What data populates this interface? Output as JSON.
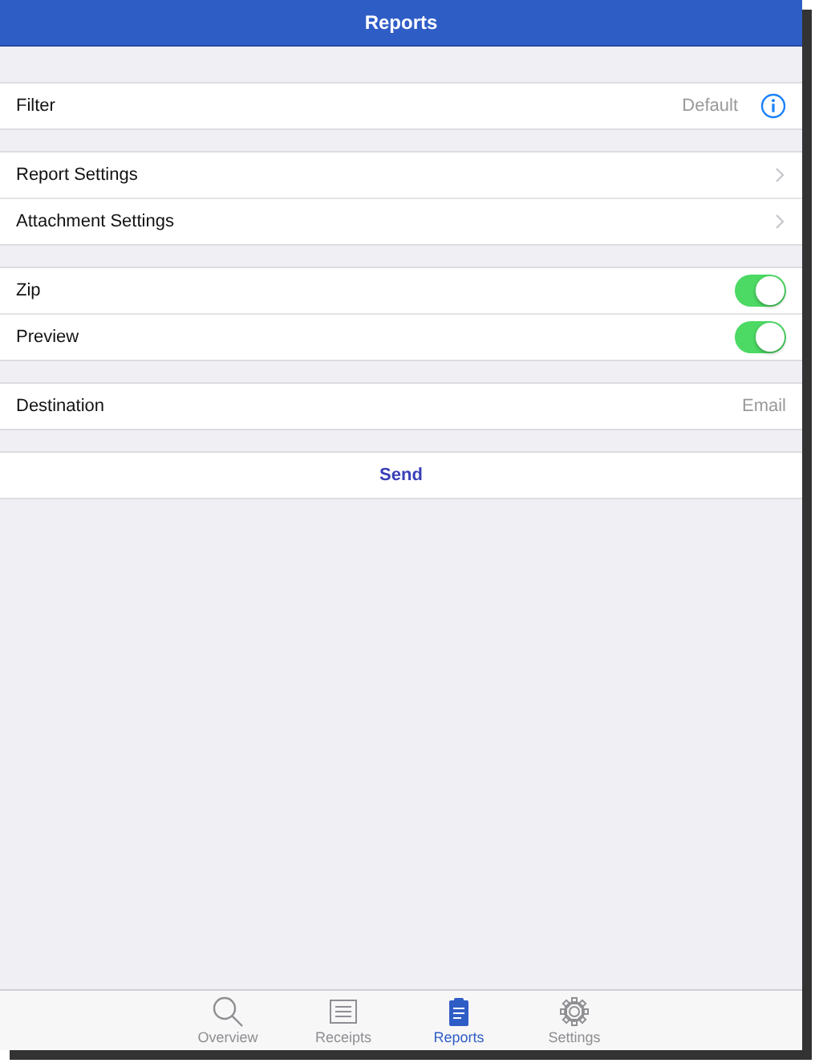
{
  "nav_bar": {
    "title": "Reports"
  },
  "sections": [
    {
      "rows": [
        {
          "kind": "info",
          "label": "Filter",
          "value": "Default"
        }
      ]
    },
    {
      "rows": [
        {
          "kind": "disclosure",
          "label": "Report Settings"
        },
        {
          "kind": "disclosure",
          "label": "Attachment Settings"
        }
      ]
    },
    {
      "rows": [
        {
          "kind": "toggle",
          "label": "Zip",
          "on": true
        },
        {
          "kind": "toggle",
          "label": "Preview",
          "on": true
        }
      ]
    },
    {
      "rows": [
        {
          "kind": "value",
          "label": "Destination",
          "value": "Email"
        }
      ]
    },
    {
      "rows": [
        {
          "kind": "action",
          "label": "Send"
        }
      ]
    }
  ],
  "tab_bar": [
    {
      "kind": "search",
      "label": "Overview",
      "selected": false
    },
    {
      "kind": "receipt",
      "label": "Receipts",
      "selected": false
    },
    {
      "kind": "clipboard",
      "label": "Reports",
      "selected": true
    },
    {
      "kind": "gear",
      "label": "Settings",
      "selected": false
    }
  ]
}
